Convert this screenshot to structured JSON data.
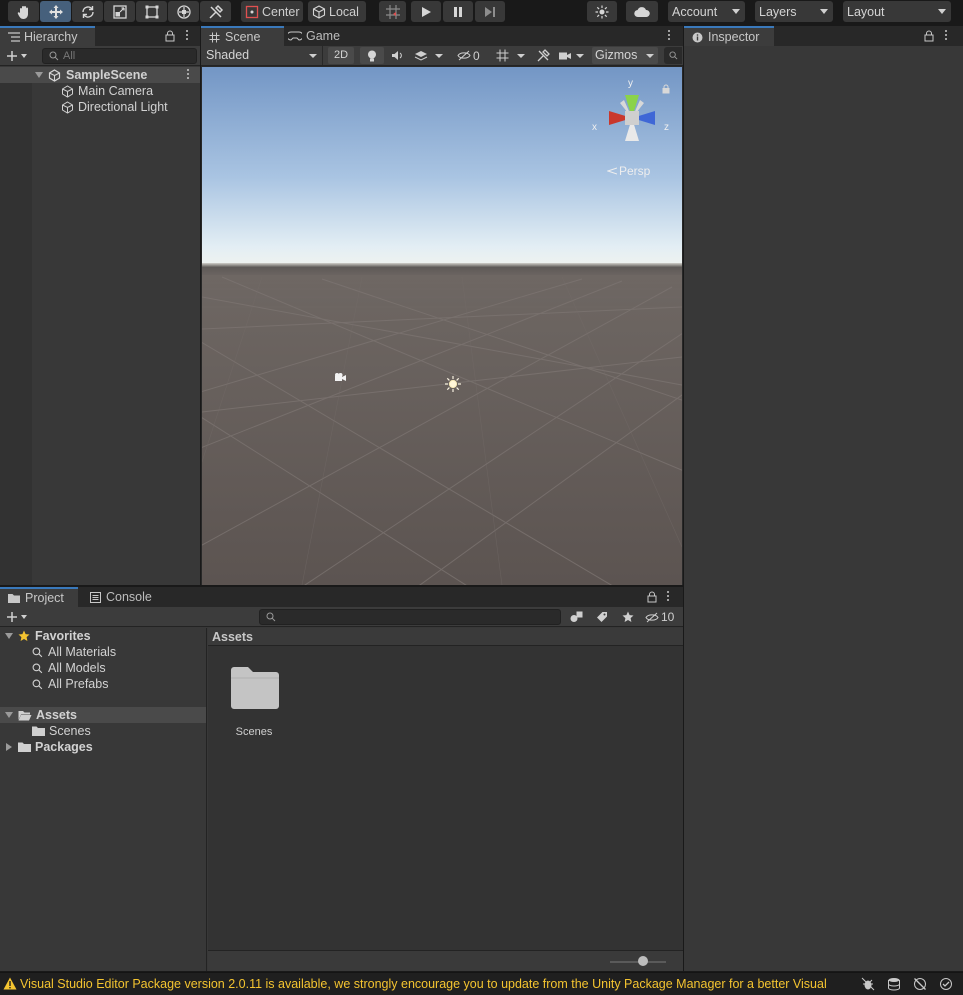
{
  "toolbar": {
    "tools": [
      "hand-icon",
      "move-icon",
      "rotate-icon",
      "scale-icon",
      "rect-icon",
      "transform-icon",
      "custom-tool-icon"
    ],
    "pivot_mode": "Center",
    "pivot_rotation": "Local",
    "account": "Account",
    "layers": "Layers",
    "layout": "Layout"
  },
  "hierarchy": {
    "tab": "Hierarchy",
    "search_placeholder": "All",
    "scene": "SampleScene",
    "items": [
      "Main Camera",
      "Directional Light"
    ]
  },
  "scene_view": {
    "tab_scene": "Scene",
    "tab_game": "Game",
    "shading_mode": "Shaded",
    "mode_2d": "2D",
    "hidden_count": "0",
    "gizmos": "Gizmos",
    "persp": "Persp",
    "axis_x": "x",
    "axis_y": "y",
    "axis_z": "z",
    "sky_color": "#7fa3cf",
    "ground_color": "#6b6360"
  },
  "inspector": {
    "tab": "Inspector"
  },
  "project": {
    "tab_project": "Project",
    "tab_console": "Console",
    "hidden_packages_count": "10",
    "favorites_label": "Favorites",
    "favorites": [
      "All Materials",
      "All Models",
      "All Prefabs"
    ],
    "assets_label": "Assets",
    "assets_children": [
      "Scenes"
    ],
    "packages_label": "Packages",
    "breadcrumb": "Assets",
    "grid_items": [
      "Scenes"
    ]
  },
  "status": {
    "message": "Visual Studio Editor Package version 2.0.11 is available, we strongly encourage you to update from the Unity Package Manager for a better Visual",
    "warning_color": "#f4c430"
  }
}
